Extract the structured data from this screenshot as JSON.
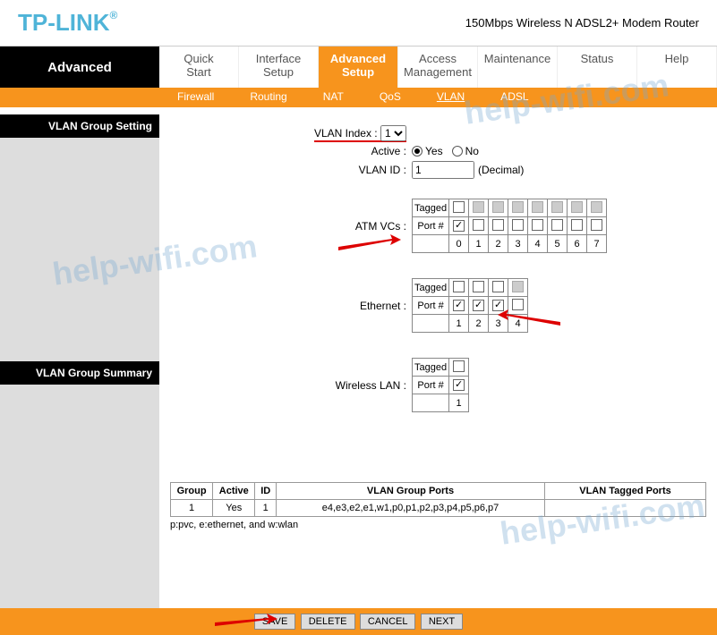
{
  "header": {
    "logo": "TP-LINK",
    "logo_sup": "®",
    "product": "150Mbps Wireless N ADSL2+ Modem Router"
  },
  "nav": {
    "left": "Advanced",
    "tabs": [
      {
        "l1": "Quick",
        "l2": "Start"
      },
      {
        "l1": "Interface",
        "l2": "Setup"
      },
      {
        "l1": "Advanced",
        "l2": "Setup"
      },
      {
        "l1": "Access",
        "l2": "Management"
      },
      {
        "l1": "Maintenance",
        "l2": ""
      },
      {
        "l1": "Status",
        "l2": ""
      },
      {
        "l1": "Help",
        "l2": ""
      }
    ],
    "active_index": 2
  },
  "subnav": {
    "tabs": [
      "Firewall",
      "Routing",
      "NAT",
      "QoS",
      "VLAN",
      "ADSL"
    ],
    "active_index": 4
  },
  "section_setting": "VLAN Group Setting",
  "section_summary": "VLAN Group Summary",
  "form": {
    "vlan_index_label": "VLAN Index :",
    "vlan_index_value": "1",
    "active_label": "Active :",
    "active_yes": "Yes",
    "active_no": "No",
    "vlan_id_label": "VLAN ID :",
    "vlan_id_value": "1",
    "vlan_id_suffix": "(Decimal)",
    "atm_label": "ATM VCs :",
    "eth_label": "Ethernet :",
    "wlan_label": "Wireless LAN :",
    "row_tagged": "Tagged",
    "row_port": "Port #"
  },
  "atm": {
    "ports": [
      "0",
      "1",
      "2",
      "3",
      "4",
      "5",
      "6",
      "7"
    ],
    "tagged_enabled": [
      true,
      false,
      false,
      false,
      false,
      false,
      false,
      false
    ],
    "port_checked": [
      true,
      false,
      false,
      false,
      false,
      false,
      false,
      false
    ]
  },
  "eth": {
    "ports": [
      "1",
      "2",
      "3",
      "4"
    ],
    "tagged_enabled": [
      true,
      true,
      true,
      false
    ],
    "port_checked": [
      true,
      true,
      true,
      false
    ]
  },
  "wlan": {
    "ports": [
      "1"
    ],
    "port_checked": [
      true
    ]
  },
  "summary": {
    "cols": [
      "Group",
      "Active",
      "ID",
      "VLAN Group Ports",
      "VLAN Tagged Ports"
    ],
    "row": {
      "group": "1",
      "active": "Yes",
      "id": "1",
      "ports": "e4,e3,e2,e1,w1,p0,p1,p2,p3,p4,p5,p6,p7",
      "tagged": ""
    },
    "legend": "p:pvc, e:ethernet, and w:wlan"
  },
  "buttons": {
    "save": "SAVE",
    "delete": "DELETE",
    "cancel": "CANCEL",
    "next": "NEXT"
  },
  "watermark": "help-wifi.com"
}
